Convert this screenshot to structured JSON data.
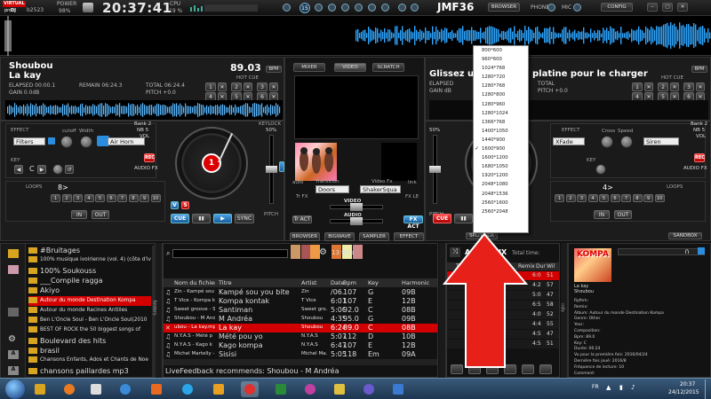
{
  "topbar": {
    "brand_top": "VIRTUAL",
    "brand_line2": "DJ",
    "pro_text": "pro",
    "build": "b2523",
    "power_label": "POWER",
    "power_value": "98%",
    "clock": "20:37:41",
    "cpu_label": "CPU",
    "cpu_value": "19 %",
    "badge_number": "15",
    "profile_name": "JMF36",
    "browser_btn": "BROWSER",
    "phone_label": "PHONE",
    "mic_label": "MIC",
    "config_btn": "CONFIG"
  },
  "deck_left": {
    "title": "Shoubou",
    "artist": "La kay",
    "bpm": "89.03",
    "bpm_unit": "BPM",
    "elapsed": "ELAPSED 00:00.1",
    "remain": "REMAIN 06:24.3",
    "total": "TOTAL 06:24.4",
    "gain": "GAIN 0.0dB",
    "pitch": "PITCH +0.0",
    "hot_cue": "HOT CUE",
    "hotcues": [
      "1",
      "2",
      "3",
      "4",
      "5",
      "6"
    ],
    "effect_label": "EFFECT",
    "effect_value": "Filters",
    "cutoff": "cutoff",
    "width": "Width",
    "sampler_value": "Air Horn",
    "bank": "Bank 2",
    "nb": "NB 5",
    "vol": "VOL",
    "rec": "REC",
    "audio_fx": "AUDIO FX",
    "key_label": "KEY",
    "key_value": "C",
    "keylock": "KEYLOCK",
    "keylock_pct": "50%",
    "loops_label": "LOOPS",
    "loop_value": "8>",
    "loop_buttons": [
      "1",
      "2",
      "3",
      "4",
      "5",
      "6",
      "7",
      "8",
      "9",
      "10"
    ],
    "in_btn": "IN",
    "out_btn": "OUT",
    "v_btn": "V",
    "s_btn": "S",
    "cue_btn": "CUE",
    "pause_btn": "▮▮",
    "play_btn": "▶",
    "sync_btn": "SYNC",
    "pitch_label": "PITCH",
    "disc_number": "1"
  },
  "deck_right": {
    "title": "Glissez un titre sur la platine pour le charger",
    "title_visible": "Glissez u",
    "title_visible_end": "platine pour le charger",
    "elapsed": "ELAPSED",
    "gain": "GAIN dB",
    "total": "TOTAL",
    "pitch": "PITCH +0.0",
    "bpm_unit": "BPM",
    "hot_cue": "HOT CUE",
    "hotcues": [
      "1",
      "2",
      "3",
      "4",
      "5",
      "6"
    ],
    "effect_label": "EFFECT",
    "effect_value": "XFade",
    "cross": "Cross",
    "speed": "Speed",
    "sampler_value": "Siren",
    "bank": "Bank 2",
    "nb": "NB 5",
    "vol": "VOL",
    "rec": "REC",
    "audio_fx": "AUDIO FX",
    "key_label": "KEY",
    "keylock_pct": "50%",
    "loops_label": "LOOPS",
    "loop_value": "4>",
    "in_btn": "IN",
    "out_btn": "OUT",
    "cue_btn": "CUE",
    "pitch_label": "PITCH"
  },
  "mixer": {
    "tabs": [
      "MIXER",
      "VIDEO",
      "SCRATCH"
    ],
    "auto": "auto",
    "transition": "Transition",
    "transition_value": "Doors",
    "video_fx": "Video Fx",
    "video_fx_value": "ShakerSqua",
    "link": "link",
    "tr_fx": "Tr FX",
    "fx_le": "FX LE",
    "video_label": "VIDEO",
    "audio_label": "AUDIO",
    "tr_act": "Tr ACT",
    "fx_act": "FX ACT",
    "bottom_tabs": [
      "BROWSER",
      "BIGWAVE",
      "SAMPLER",
      "EFFECT"
    ],
    "split_scr": "SPLIT SCR",
    "sandbox": "SANDBOX"
  },
  "dropdown": {
    "items": [
      "800*600",
      "960*600",
      "1024*768",
      "1280*720",
      "1280*768",
      "1280*800",
      "1280*960",
      "1280*1024",
      "1366*768",
      "1400*1050",
      "1440*900",
      "1600*900",
      "1600*1200",
      "1680*1050",
      "1920*1200",
      "2048*1080",
      "2048*1536",
      "2560*1600",
      "2560*2048"
    ],
    "checked_index": 11
  },
  "browser": {
    "tree_items": [
      {
        "label": "#Bruitages",
        "type": "folder"
      },
      {
        "label": "100% musique ivoirienne (vol. 4) (côte d'iv",
        "type": "folder"
      },
      {
        "label": "100% Soukouss",
        "type": "folder"
      },
      {
        "label": "___Compile ragga",
        "type": "folder"
      },
      {
        "label": "Akiyo",
        "type": "folder"
      },
      {
        "label": "Autour du monde Destination Kompa",
        "type": "folder",
        "selected": true
      },
      {
        "label": "Autour du monde Racines Antilles",
        "type": "folder"
      },
      {
        "label": "Ben L'Oncle Soul - Ben L'Oncle Soul(2010",
        "type": "folder"
      },
      {
        "label": "BEST OF ROCK the 50 biggest songs of",
        "type": "folder"
      },
      {
        "label": "Boulevard des hits",
        "type": "folder"
      },
      {
        "label": "brasil",
        "type": "folder"
      },
      {
        "label": "Chansons Enfants, Ados et Chants de Noe",
        "type": "folder"
      },
      {
        "label": "chansons paillardes  mp3",
        "type": "folder"
      }
    ],
    "files_count": "13 files",
    "columns": [
      "Nom du fichier",
      "Titre",
      "Artist",
      "Date",
      "Bpm",
      "Key",
      "Harmonic"
    ],
    "rows": [
      {
        "file": "Zin - Kampé sou",
        "title": "Kampé sou you bite",
        "artist": "Zin",
        "date": "/06...",
        "bpm": "107",
        "key": "G",
        "harm": "09B"
      },
      {
        "file": "T Vice - Kompa k",
        "title": "Kompa kontak",
        "artist": "T Vice",
        "date": "6:01",
        "bpm": "107",
        "key": "E",
        "harm": "12B"
      },
      {
        "file": "Sweet groove - S",
        "title": "Santiman",
        "artist": "Sweet gro.",
        "date": "5:00",
        "bpm": "92.0",
        "key": "C",
        "harm": "08B"
      },
      {
        "file": "Shoubou - M Andr",
        "title": "M Andréa",
        "artist": "Shoubou",
        "date": "4:35",
        "bpm": "95.0",
        "key": "G",
        "harm": "09B"
      },
      {
        "file": "ubou - La kay.mp3",
        "title": "La kay",
        "artist": "Shoubou",
        "date": "6:24",
        "bpm": "89.0",
        "key": "C",
        "harm": "08B",
        "selected": true
      },
      {
        "file": "N.Y.A.S - Mété p",
        "title": "Mété pou yo",
        "artist": "N.Y.A.S",
        "date": "5:07",
        "bpm": "112",
        "key": "D",
        "harm": "10B"
      },
      {
        "file": "N.Y.A.S - Kago k",
        "title": "Kago kompa",
        "artist": "N.Y.A.S",
        "date": "6:47",
        "bpm": "107",
        "key": "E",
        "harm": "12B"
      },
      {
        "file": "Michel Martelly -",
        "title": "Sisisi",
        "artist": "Michel Ma.",
        "date": "5:05",
        "bpm": "118",
        "key": "Em",
        "harm": "09A"
      }
    ],
    "live_feedback": "LiveFeedback recommends: Shoubou - M Andréa",
    "side_tabs": [
      "folders",
      "sideview",
      "info"
    ]
  },
  "automix": {
    "title": "AUTOMIX",
    "title_visible_a": "AU",
    "title_visible_b": "MIX",
    "total_time": "Total time:",
    "columns": [
      "Titre",
      "Remix",
      "Dur",
      "Wil"
    ],
    "rows": [
      {
        "dur": "6:0",
        "wil": "51",
        "selected": true
      },
      {
        "title": "enc...",
        "dur": "4:2",
        "wil": "57"
      },
      {
        "title": "lenc...",
        "dur": "5:0",
        "wil": "47"
      },
      {
        "title": "Versic...",
        "dur": "6:5",
        "wil": "58"
      },
      {
        "title": "enc...",
        "dur": "4:0",
        "wil": "52"
      },
      {
        "title": "enc...",
        "dur": "4:4",
        "wil": "55"
      },
      {
        "title": "enc...",
        "dur": "4:5",
        "wil": "47"
      },
      {
        "title": "enc...",
        "dur": "4:5",
        "wil": "51"
      }
    ]
  },
  "info_panel": {
    "cover_title": "KOMPA",
    "song_line1": "La kay",
    "song_line2": "Shoubou",
    "details": [
      "Rythm:",
      "Remix:",
      "Album: Autour du monde Destination Kompa",
      "Genre: Other",
      "Year:",
      "Composition:",
      "Bpm: 89.0",
      "Key: C",
      "Durée: 06:24",
      "Vu pour la première fois: 2016/04/24",
      "Dernière fois joué: 2016/8",
      "Fréquence de lecture: 10",
      "Comment:"
    ]
  },
  "taskbar": {
    "lang": "FR",
    "time": "20:37",
    "date": "24/12/2015"
  },
  "colors": {
    "accent_blue": "#2a8ee0",
    "selection_red": "#d20000",
    "wave_blue": "#2fa6ff"
  }
}
